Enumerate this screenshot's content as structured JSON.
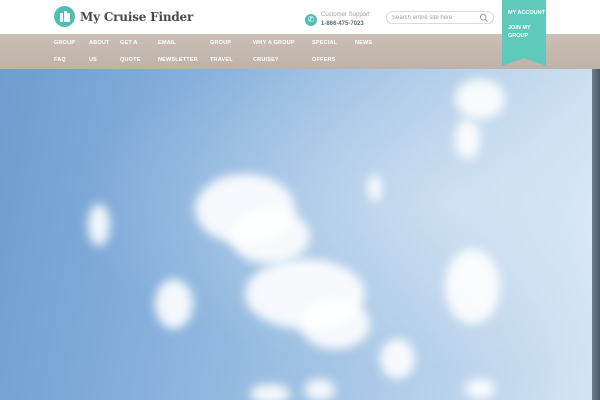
{
  "header": {
    "logo_text": "My Cruise Finder",
    "support_label": "Customer Support",
    "support_phone": "1-866-475-7023",
    "search_placeholder": "Search entire site here"
  },
  "nav": {
    "items": [
      {
        "line1": "GROUP",
        "line2": "FAQ"
      },
      {
        "line1": "ABOUT",
        "line2": "US"
      },
      {
        "line1": "GET A",
        "line2": "QUOTE"
      },
      {
        "line1": "EMAIL",
        "line2": "NEWSLETTER"
      },
      {
        "line1": "GROUP",
        "line2": "TRAVEL"
      },
      {
        "line1": "WHY A GROUP",
        "line2": "CRUISE?"
      },
      {
        "line1": "SPECIAL",
        "line2": "OFFERS"
      },
      {
        "line1": "NEWS",
        "line2": ""
      }
    ]
  },
  "account": {
    "my_account": "MY ACCOUNT",
    "join_group": "JOIN MY GROUP"
  },
  "colors": {
    "accent": "#4fbfb2",
    "nav_background": "#c5b9af",
    "sky": "#8db5df"
  },
  "icons": {
    "logo": "suitcase-icon",
    "phone": "phone-icon",
    "search": "search-icon"
  }
}
